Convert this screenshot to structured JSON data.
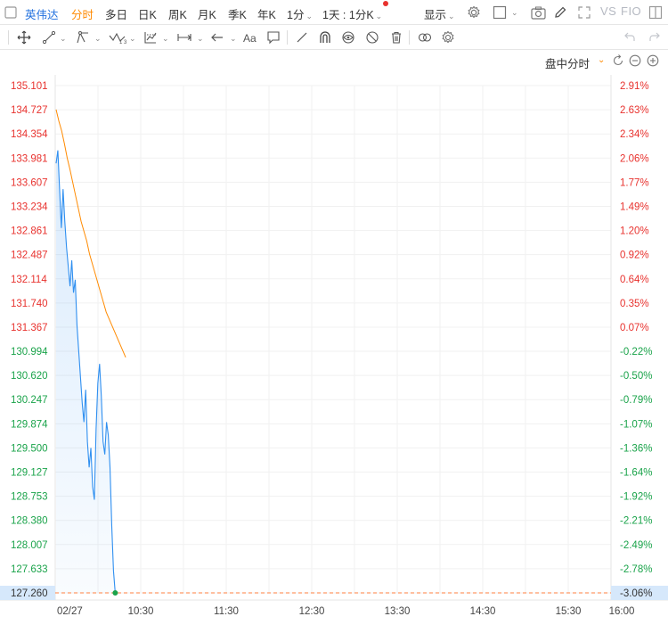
{
  "toolbar": {
    "stock_name": "英伟达",
    "periods": [
      "分时",
      "多日",
      "日K",
      "周K",
      "月K",
      "季K",
      "年K"
    ],
    "active_period": "分时",
    "interval": "1分",
    "range_select": "1天 : 1分K",
    "display": "显示",
    "compare": "VS",
    "fio": "FIO",
    "icons": [
      "settings-gear-icon",
      "square-icon",
      "camera-icon",
      "pencil-icon",
      "fullscreen-icon",
      "window-icon"
    ]
  },
  "drawing_toolbar": {
    "icons": [
      "move-crosshair-icon",
      "trend-line-icon",
      "pitchfork-icon",
      "wave-pattern-icon",
      "fibonacci-icon",
      "range-measure-icon",
      "arrow-left-icon",
      "text-aa-icon",
      "comment-icon",
      "ruler-icon",
      "magnet-icon",
      "eye-lock-icon",
      "eye-hide-icon",
      "trash-icon",
      "link-chain-icon",
      "drawing-settings-icon",
      "undo-icon",
      "redo-icon"
    ]
  },
  "mode": {
    "label": "盘中分时",
    "icons": [
      "refresh-icon",
      "zoom-out-icon",
      "zoom-in-icon"
    ]
  },
  "chart_data": {
    "type": "line",
    "date_label": "02/27",
    "x_ticks": [
      "10:30",
      "11:30",
      "12:30",
      "13:30",
      "14:30",
      "15:30",
      "16:00"
    ],
    "price_ticks": [
      "135.101",
      "134.727",
      "134.354",
      "133.981",
      "133.607",
      "133.234",
      "132.861",
      "132.487",
      "132.114",
      "131.740",
      "131.367",
      "130.994",
      "130.620",
      "130.247",
      "129.874",
      "129.500",
      "129.127",
      "128.753",
      "128.380",
      "128.007",
      "127.633",
      "127.260"
    ],
    "pct_ticks": [
      "2.91%",
      "2.63%",
      "2.34%",
      "2.06%",
      "1.77%",
      "1.49%",
      "1.20%",
      "0.92%",
      "0.64%",
      "0.35%",
      "0.07%",
      "-0.22%",
      "-0.50%",
      "-0.79%",
      "-1.07%",
      "-1.36%",
      "-1.64%",
      "-1.92%",
      "-2.21%",
      "-2.49%",
      "-2.78%",
      "-3.06%"
    ],
    "ylim": [
      127.26,
      135.101
    ],
    "last_price": "127.260",
    "last_pct": "-3.06%",
    "colors": {
      "up": "#e8322e",
      "down": "#1aa34a",
      "price_line": "#2f8ff0",
      "avg_line": "#ff8a00",
      "last_line": "#ff7f3f",
      "last_point": "#1aa34a",
      "highlight_bg": "#d6e8fb"
    },
    "series": [
      {
        "values": [
          133.9,
          134.1,
          133.5,
          132.9,
          133.5,
          133.0,
          132.6,
          132.3,
          132.0,
          132.4,
          131.9,
          132.1,
          131.4,
          131.0,
          130.6,
          130.2,
          129.9,
          130.4,
          129.6,
          129.2,
          129.5,
          128.9,
          128.7,
          129.8,
          130.5,
          130.8,
          130.3,
          129.6,
          129.4,
          129.9,
          129.7,
          129.2,
          128.3,
          127.6,
          127.26
        ]
      },
      {
        "values": [
          134.73,
          134.55,
          134.4,
          134.2,
          133.98,
          133.8,
          133.6,
          133.4,
          133.2,
          133.0,
          132.85,
          132.7,
          132.5,
          132.35,
          132.2,
          132.05,
          131.9,
          131.75,
          131.6,
          131.5,
          131.4,
          131.3,
          131.2,
          131.1,
          131.0,
          130.9
        ]
      }
    ]
  }
}
